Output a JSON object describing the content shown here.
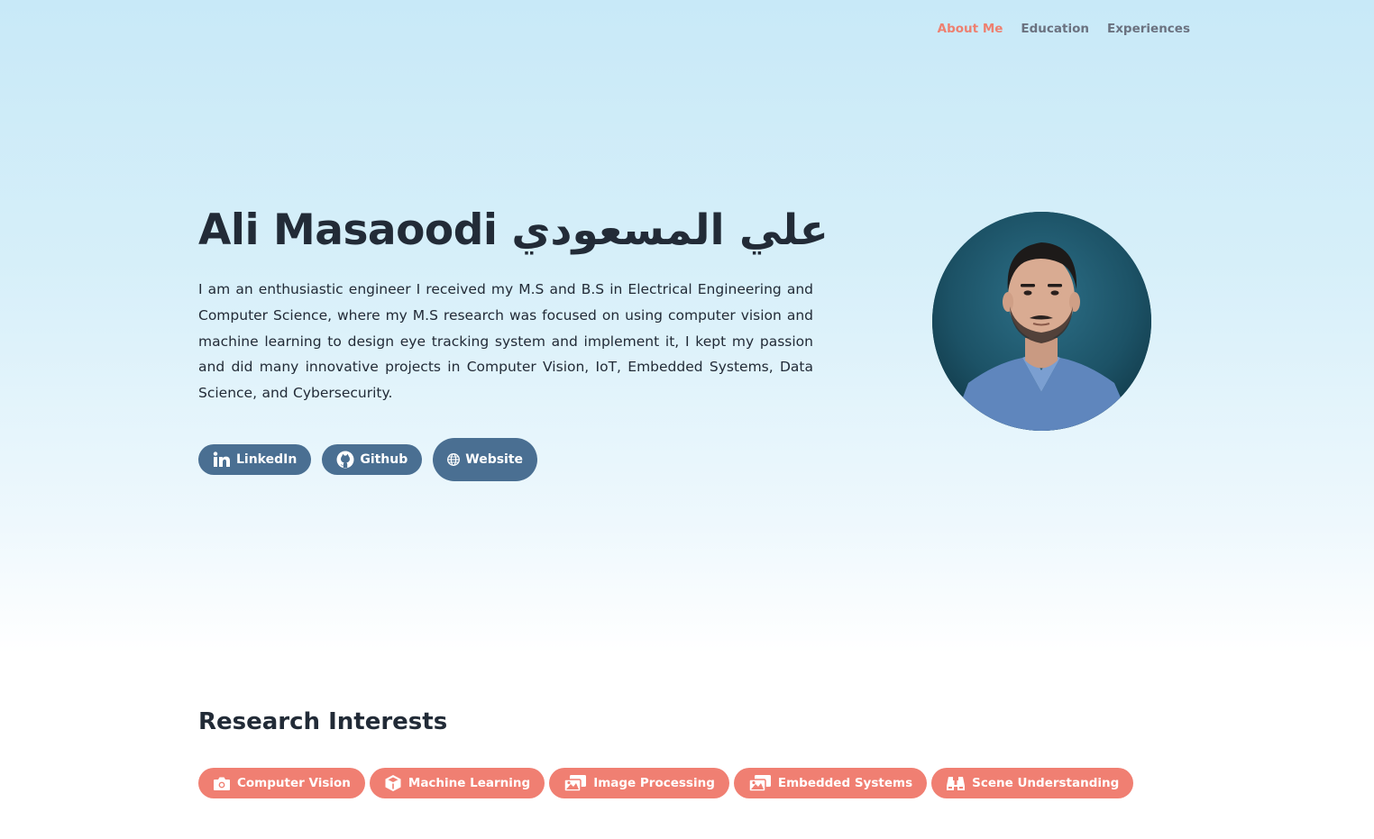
{
  "nav": {
    "items": [
      "About Me",
      "Education",
      "Experiences"
    ],
    "active_index": 0
  },
  "profile": {
    "name": "Ali Masaoodi علي المسعودي",
    "bio": "I am an enthusiastic engineer I received my M.S and B.S in Electrical Engineering and Computer Science, where my M.S research was focused on using computer vision and machine learning to design eye tracking system and implement it, I kept my passion and did many innovative projects in Computer Vision, IoT, Embedded Systems, Data Science, and Cybersecurity."
  },
  "links": [
    {
      "label": "LinkedIn",
      "icon": "linkedin-icon"
    },
    {
      "label": "Github",
      "icon": "github-icon"
    },
    {
      "label": "Website",
      "icon": "globe-icon"
    }
  ],
  "research": {
    "title": "Research Interests",
    "tags": [
      {
        "label": "Computer Vision",
        "icon": "camera-icon"
      },
      {
        "label": "Machine Learning",
        "icon": "cube-icon"
      },
      {
        "label": "Image Processing",
        "icon": "images-icon"
      },
      {
        "label": "Embedded Systems",
        "icon": "images-icon"
      },
      {
        "label": "Scene Understanding",
        "icon": "binoculars-icon"
      }
    ]
  },
  "colors": {
    "accent": "#ee8070",
    "link_button": "#4a6f92",
    "tag": "#f07f72",
    "heading": "#222b37"
  }
}
